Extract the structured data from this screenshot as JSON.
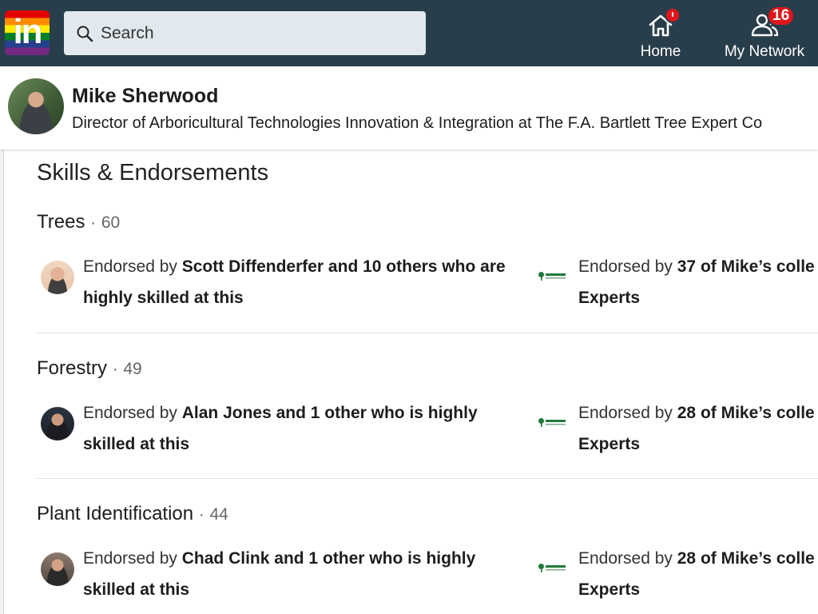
{
  "nav": {
    "logo_text": "in",
    "search_placeholder": "Search",
    "home_label": "Home",
    "network_label": "My Network",
    "network_badge": "16"
  },
  "profile": {
    "name": "Mike Sherwood",
    "headline": "Director of Arboricultural Technologies Innovation & Integration at The F.A. Bartlett Tree Expert Co"
  },
  "section": {
    "title": "Skills & Endorsements"
  },
  "skills": [
    {
      "name": "Trees",
      "separator": "·",
      "count": "60",
      "endorse_prefix": "Endorsed by ",
      "endorse_bold": "Scott Diffenderfer and 10 others who are highly skilled at this",
      "colleague_prefix": "Endorsed by ",
      "colleague_bold_1": "37 of Mike’s colle",
      "colleague_bold_2": "Experts"
    },
    {
      "name": "Forestry",
      "separator": "·",
      "count": "49",
      "endorse_prefix": "Endorsed by ",
      "endorse_bold": "Alan Jones and 1 other who is highly skilled at this",
      "colleague_prefix": "Endorsed by ",
      "colleague_bold_1": "28 of Mike’s colle",
      "colleague_bold_2": "Experts"
    },
    {
      "name": "Plant Identification",
      "separator": "·",
      "count": "44",
      "endorse_prefix": "Endorsed by ",
      "endorse_bold": "Chad Clink and 1 other who is highly skilled at this",
      "colleague_prefix": "Endorsed by ",
      "colleague_bold_1": "28 of Mike’s colle",
      "colleague_bold_2": "Experts"
    }
  ],
  "colors": {
    "nav_bg": "#283e4a",
    "badge": "#e0151b",
    "search_bg": "#e1e9ee"
  }
}
